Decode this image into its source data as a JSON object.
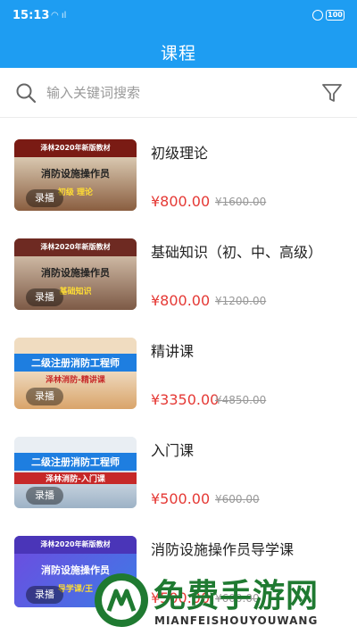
{
  "status": {
    "time": "15:13",
    "battery": "100"
  },
  "header": {
    "title": "课程"
  },
  "search": {
    "placeholder": "输入关键词搜索"
  },
  "courses": [
    {
      "name": "初级理论",
      "price": "¥800.00",
      "original": "¥1600.00",
      "tag": "录播",
      "thumb": {
        "top": "泽林2020年新版教材",
        "mid": "消防设施操作员",
        "low": "初级 理论"
      }
    },
    {
      "name": "基础知识（初、中、高级）",
      "price": "¥800.00",
      "original": "¥1200.00",
      "tag": "录播",
      "thumb": {
        "top": "泽林2020年新版教材",
        "mid": "消防设施操作员",
        "low": "基础知识"
      }
    },
    {
      "name": "精讲课",
      "price": "¥3350.00",
      "original": "¥4850.00",
      "tag": "录播",
      "thumb": {
        "top": "",
        "mid": "二级注册消防工程师",
        "low": "泽林消防-精讲课"
      }
    },
    {
      "name": "入门课",
      "price": "¥500.00",
      "original": "¥600.00",
      "tag": "录播",
      "thumb": {
        "top": "",
        "mid": "二级注册消防工程师",
        "low": "泽林消防-入门课"
      }
    },
    {
      "name": "消防设施操作员导学课",
      "price": "¥500.00",
      "original": "¥600.00",
      "tag": "录播",
      "thumb": {
        "top": "泽林2020年新版教材",
        "mid": "消防设施操作员",
        "low": "导学课/王"
      }
    }
  ],
  "watermark": {
    "title": "免费手游网",
    "sub": "MIANFEISHOUYOUWANG"
  }
}
